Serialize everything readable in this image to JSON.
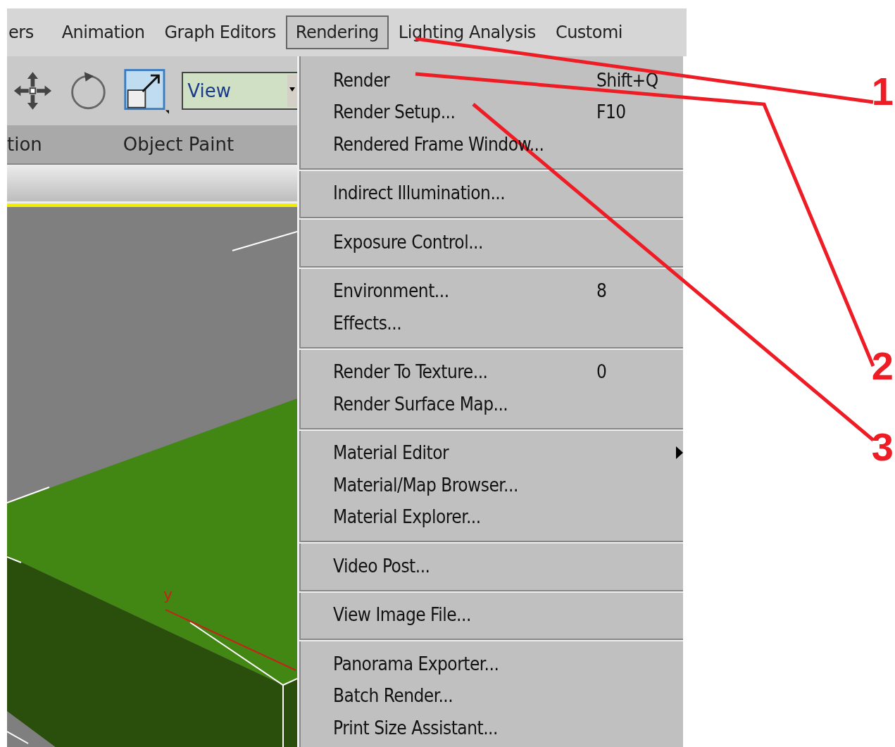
{
  "menu_bar": [
    {
      "label": "ers",
      "selected": false
    },
    {
      "label": "Animation",
      "selected": false
    },
    {
      "label": "Graph Editors",
      "selected": false
    },
    {
      "label": "Rendering",
      "selected": true
    },
    {
      "label": "Lighting Analysis",
      "selected": false
    },
    {
      "label": "Customi",
      "selected": false
    }
  ],
  "toolbar": {
    "view_dropdown": {
      "value": "View"
    }
  },
  "ribbon_tabs": [
    "tion",
    "Object Paint"
  ],
  "viewport": {
    "kind": "picture",
    "axis_label": "y"
  },
  "rendering_menu": {
    "groups": [
      [
        {
          "label": "Render",
          "shortcut": "Shift+Q"
        },
        {
          "label": "Render Setup...",
          "shortcut": "F10"
        },
        {
          "label": "Rendered Frame Window..."
        }
      ],
      [
        {
          "label": "Indirect Illumination..."
        }
      ],
      [
        {
          "label": "Exposure Control..."
        }
      ],
      [
        {
          "label": "Environment...",
          "shortcut": "8"
        },
        {
          "label": "Effects..."
        }
      ],
      [
        {
          "label": "Render To Texture...",
          "shortcut": "0"
        },
        {
          "label": "Render Surface Map..."
        }
      ],
      [
        {
          "label": "Material Editor",
          "submenu": true
        },
        {
          "label": "Material/Map Browser..."
        },
        {
          "label": "Material Explorer..."
        }
      ],
      [
        {
          "label": "Video Post..."
        }
      ],
      [
        {
          "label": "View Image File..."
        }
      ],
      [
        {
          "label": "Panorama Exporter..."
        },
        {
          "label": "Batch Render..."
        },
        {
          "label": "Print Size Assistant..."
        }
      ]
    ]
  },
  "callouts": [
    "1",
    "2",
    "3"
  ]
}
